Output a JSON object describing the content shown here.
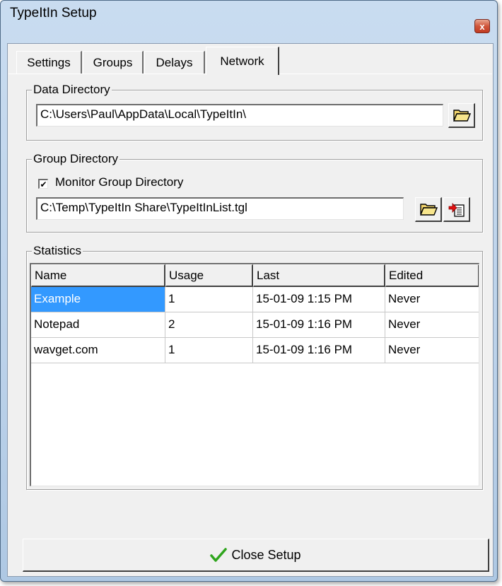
{
  "window": {
    "title": "TypeItIn Setup",
    "close_glyph": "x"
  },
  "tabs": [
    {
      "label": "Settings",
      "active": false
    },
    {
      "label": "Groups",
      "active": false
    },
    {
      "label": "Delays",
      "active": false
    },
    {
      "label": "Network",
      "active": true
    }
  ],
  "data_directory": {
    "legend": "Data Directory",
    "path": "C:\\Users\\Paul\\AppData\\Local\\TypeItIn\\",
    "browse_icon": "folder-open-icon"
  },
  "group_directory": {
    "legend": "Group Directory",
    "monitor_label": "Monitor Group Directory",
    "monitor_checked": true,
    "check_glyph": "✔",
    "path": "C:\\Temp\\TypeItIn Share\\TypeItInList.tgl",
    "browse_icon": "folder-open-icon",
    "export_icon": "export-list-icon"
  },
  "statistics": {
    "legend": "Statistics",
    "columns": [
      "Name",
      "Usage",
      "Last",
      "Edited"
    ],
    "rows": [
      {
        "name": "Example",
        "usage": "1",
        "last": "15-01-09 1:15 PM",
        "edited": "Never",
        "selected": true
      },
      {
        "name": "Notepad",
        "usage": "2",
        "last": "15-01-09 1:16 PM",
        "edited": "Never",
        "selected": false
      },
      {
        "name": "wavget.com",
        "usage": "1",
        "last": "15-01-09 1:16 PM",
        "edited": "Never",
        "selected": false
      }
    ]
  },
  "footer": {
    "close_label": "Close Setup",
    "close_icon": "green-checkmark-icon"
  },
  "colors": {
    "selection": "#3399ff",
    "titlebar": "#bcd2ea",
    "close_button": "#c13b22",
    "checkmark": "#2fa51d"
  }
}
